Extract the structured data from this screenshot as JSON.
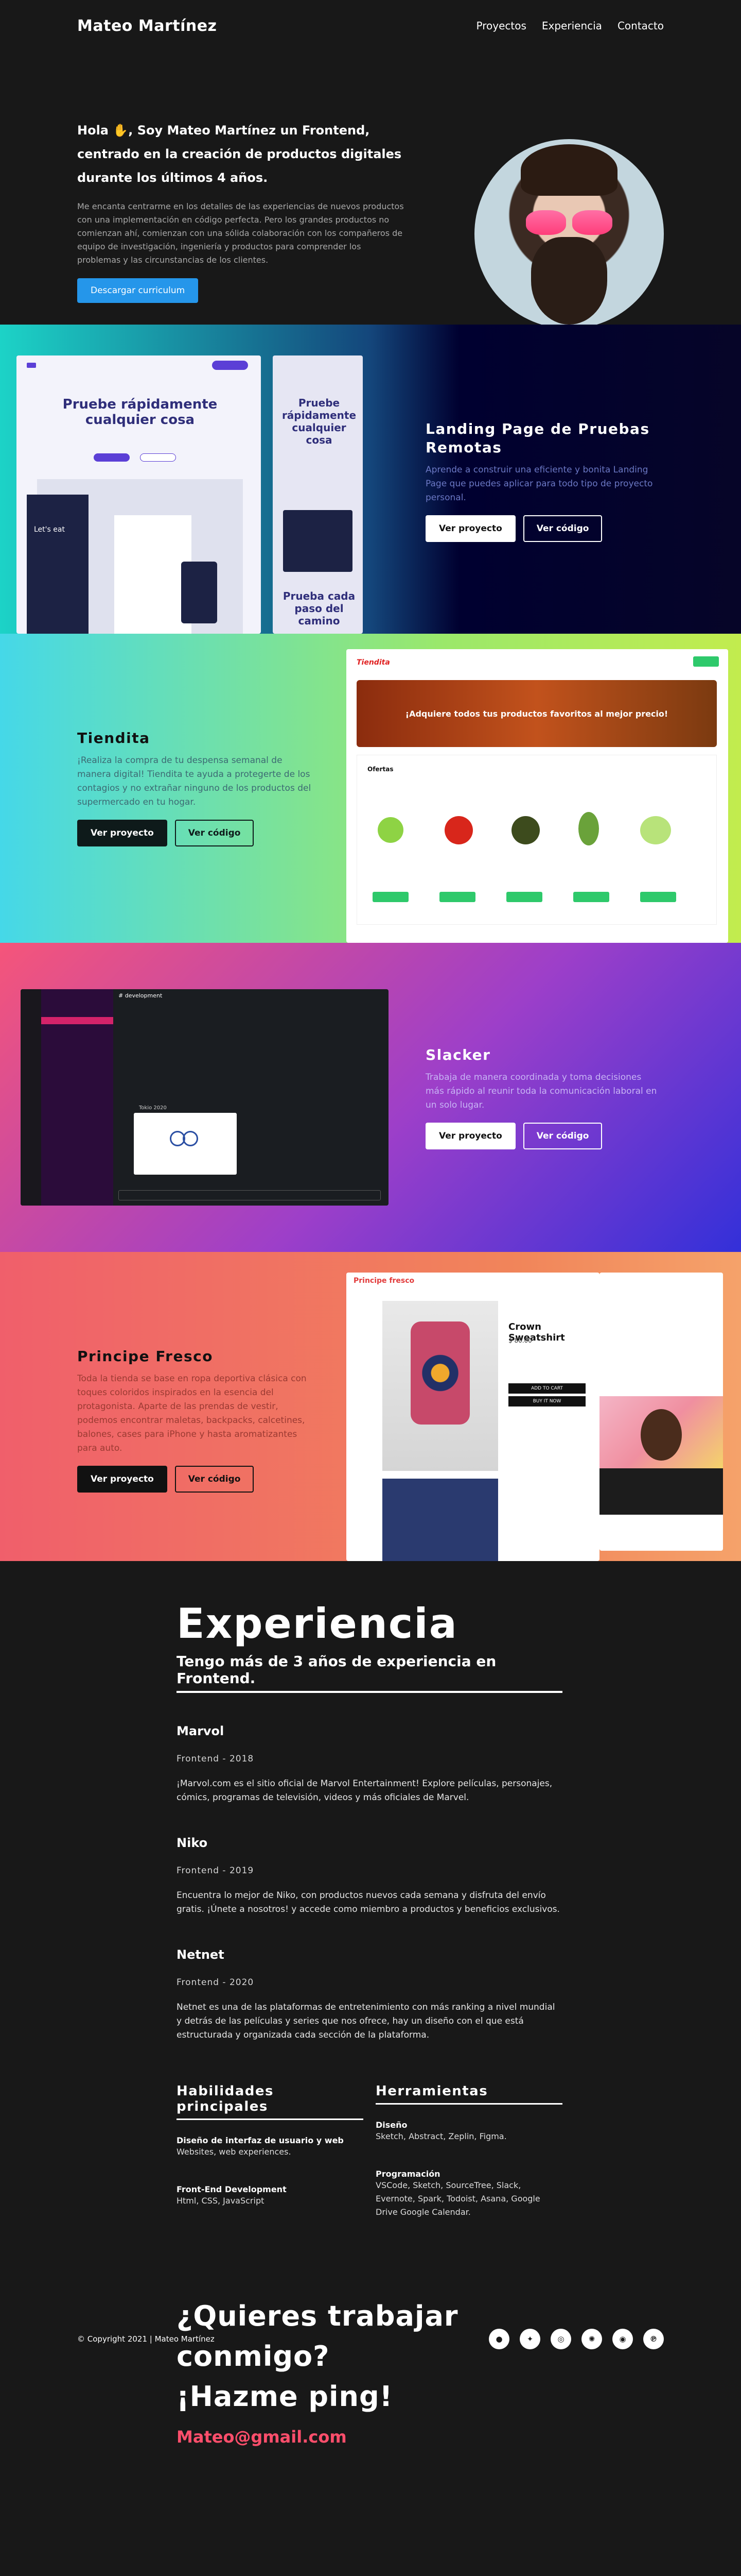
{
  "nav": {
    "brand": "Mateo Martínez",
    "links": [
      "Proyectos",
      "Experiencia",
      "Contacto"
    ]
  },
  "hero": {
    "greeting": "Hola ✋, Soy Mateo Martínez un Frontend, centrado en la creación de productos digitales durante los últimos 4 años.",
    "description": "Me encanta centrarme en los detalles de las experiencias de nuevos productos con una implementación en código perfecta. Pero los grandes productos no comienzan ahí, comienzan con una sólida colaboración con los compañeros de equipo de investigación, ingeniería y productos para comprender los problemas y las circunstancias de los clientes.",
    "cta": "Descargar curriculum"
  },
  "projects": [
    {
      "title": "Landing Page de Pruebas Remotas",
      "description": "Aprende a construir una eficiente y bonita Landing Page que puedes aplicar para todo tipo de proyecto personal.",
      "btn_project": "Ver proyecto",
      "btn_code": "Ver código",
      "mock": {
        "headline": "Pruebe rápidamente cualquier cosa",
        "headline2": "Pruebe rápidamente cualquier cosa",
        "footer": "Prueba cada paso del camino",
        "app": "Let's eat"
      }
    },
    {
      "title": "Tiendita",
      "description": "¡Realiza la compra de tu despensa semanal de manera digital! Tiendita te ayuda a protegerte de los contagios y no extrañar ninguno de los productos del supermercado en tu hogar.",
      "btn_project": "Ver proyecto",
      "btn_code": "Ver código",
      "mock": {
        "logo": "Tiendita",
        "banner": "¡Adquiere todos tus productos favoritos al mejor precio!",
        "offers": "Ofertas",
        "cart": "Agregar"
      }
    },
    {
      "title": "Slacker",
      "description": "Trabaja de manera coordinada y toma decisiones más rápido al reunir toda la comunicación laboral en un solo lugar.",
      "btn_project": "Ver proyecto",
      "btn_code": "Ver código",
      "mock": {
        "channel": "# development",
        "olympics": "Tokio 2020"
      }
    },
    {
      "title": "Principe Fresco",
      "description": "Toda la tienda se base en ropa deportiva clásica con toques coloridos inspirados en la esencia del protagonista. Aparte de las prendas de vestir, podemos encontrar maletas, backpacks, calcetines, balones, cases para iPhone y hasta aromatizantes para auto.",
      "btn_project": "Ver proyecto",
      "btn_code": "Ver código",
      "mock": {
        "logo": "Principe fresco",
        "product": "Crown Sweatshirt",
        "price": "$ 80.00",
        "add": "ADD TO CART",
        "buy": "BUY IT NOW"
      }
    }
  ],
  "experience": {
    "title": "Experiencia",
    "subtitle": "Tengo más de 3 años de experiencia en Frontend.",
    "jobs": [
      {
        "company": "Marvol",
        "date": "Frontend - 2018",
        "text": "¡Marvol.com es el sitio oficial de Marvol Entertainment! Explore películas, personajes, cómics, programas de televisión, videos y más oficiales de Marvel."
      },
      {
        "company": "Niko",
        "date": "Frontend - 2019",
        "text": "Encuentra lo mejor de Niko, con productos nuevos cada semana y disfruta del envío gratis. ¡Únete a nosotros! y accede como miembro a productos y beneficios exclusivos."
      },
      {
        "company": "Netnet",
        "date": "Frontend - 2020",
        "text": "Netnet es una de las plataformas de entretenimiento con más ranking a nivel mundial y detrás de las películas y series que nos ofrece, hay un diseño con el que está estructurada y organizada cada sección de la plataforma."
      }
    ]
  },
  "skills": {
    "title": "Habilidades principales",
    "items": [
      {
        "title": "Diseño de interfaz de usuario y web",
        "value": "Websites, web experiences."
      },
      {
        "title": "Front-End Development",
        "value": "Html, CSS, JavaScript"
      }
    ]
  },
  "tools": {
    "title": "Herramientas",
    "items": [
      {
        "title": "Diseño",
        "value": "Sketch, Abstract, Zeplin, Figma."
      },
      {
        "title": "Programación",
        "value": "VSCode, Sketch, SourceTree, Slack, Evernote, Spark, Todoist, Asana, Google Drive Google Calendar."
      }
    ]
  },
  "contact": {
    "line1": "¿Quieres trabajar",
    "line2": "conmigo?",
    "line3": "¡Hazme ping!",
    "email": "Mateo@gmail.com"
  },
  "footer": {
    "copyright": "© Copyright 2021 | Mateo Martínez",
    "social_icons": [
      "github-icon",
      "twitter-icon",
      "instagram-icon",
      "dribbble-icon",
      "discord-icon",
      "pinterest-icon"
    ]
  }
}
